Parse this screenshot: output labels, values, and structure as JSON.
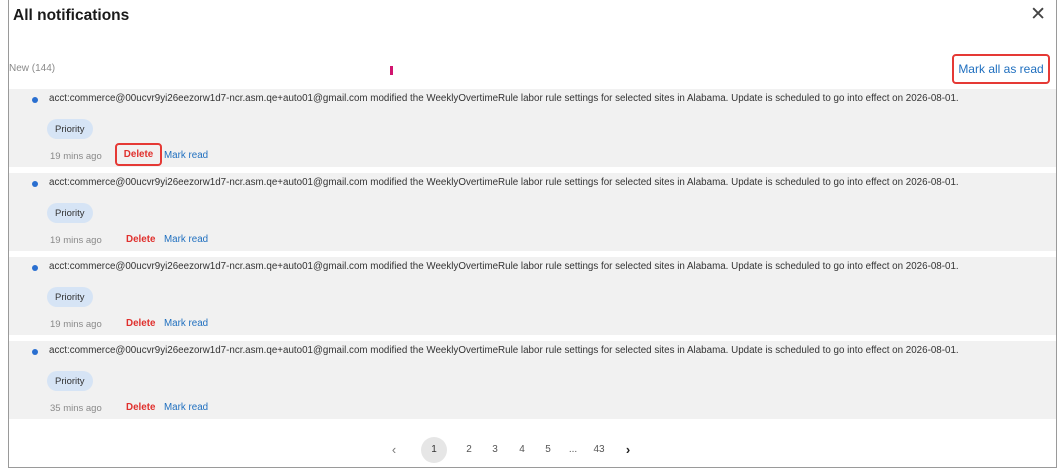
{
  "dialog": {
    "title": "All notifications",
    "close_glyph": "✕",
    "new_count_label": "New (144)",
    "mark_all_label": "Mark all as read"
  },
  "notifications": [
    {
      "message": "acct:commerce@00ucvr9yi26eezorw1d7-ncr.asm.qe+auto01@gmail.com modified the WeeklyOvertimeRule labor rule settings for selected sites in Alabama. Update is scheduled to go into effect on 2026-08-01.",
      "badge": "Priority",
      "time": "19 mins ago",
      "delete_label": "Delete",
      "mark_read_label": "Mark read"
    },
    {
      "message": "acct:commerce@00ucvr9yi26eezorw1d7-ncr.asm.qe+auto01@gmail.com modified the WeeklyOvertimeRule labor rule settings for selected sites in Alabama. Update is scheduled to go into effect on 2026-08-01.",
      "badge": "Priority",
      "time": "19 mins ago",
      "delete_label": "Delete",
      "mark_read_label": "Mark read"
    },
    {
      "message": "acct:commerce@00ucvr9yi26eezorw1d7-ncr.asm.qe+auto01@gmail.com modified the WeeklyOvertimeRule labor rule settings for selected sites in Alabama. Update is scheduled to go into effect on 2026-08-01.",
      "badge": "Priority",
      "time": "19 mins ago",
      "delete_label": "Delete",
      "mark_read_label": "Mark read"
    },
    {
      "message": "acct:commerce@00ucvr9yi26eezorw1d7-ncr.asm.qe+auto01@gmail.com modified the WeeklyOvertimeRule labor rule settings for selected sites in Alabama. Update is scheduled to go into effect on 2026-08-01.",
      "badge": "Priority",
      "time": "35 mins ago",
      "delete_label": "Delete",
      "mark_read_label": "Mark read"
    }
  ],
  "pagination": {
    "prev_glyph": "‹",
    "pages": [
      "1",
      "2",
      "3",
      "4",
      "5",
      "...",
      "43"
    ],
    "current": "1",
    "next_glyph": "›"
  },
  "colors": {
    "accent": "#1f6fbf",
    "delete": "#e0302d",
    "highlight_box": "#e53935",
    "unread_dot": "#2a6fd0",
    "badge_bg": "#d6e4f5"
  },
  "icons": {
    "close": "close-icon",
    "prev": "chevron-left-icon",
    "next": "chevron-right-icon",
    "unread": "unread-dot-icon"
  }
}
